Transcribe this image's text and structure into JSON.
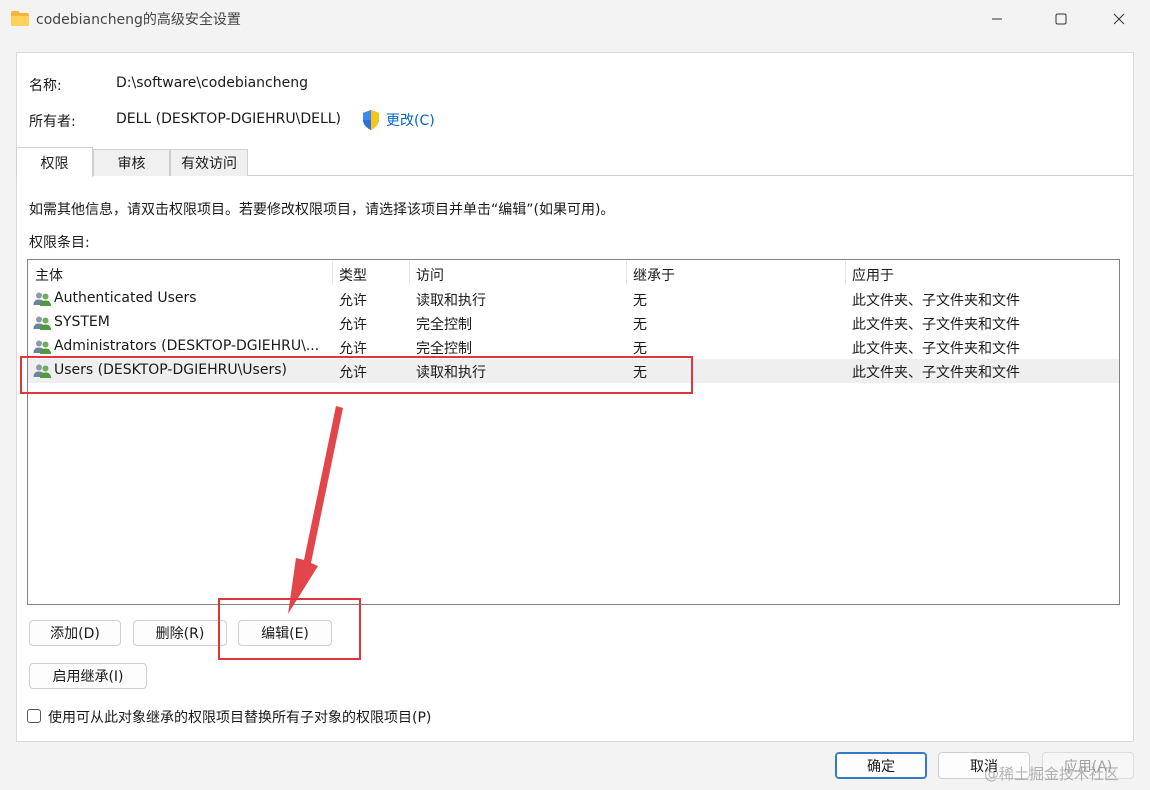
{
  "window": {
    "title": "codebiancheng的高级安全设置",
    "controls": {
      "minimize": "—",
      "maximize": "☐",
      "close": "✕"
    }
  },
  "info": {
    "name_label": "名称:",
    "name_value": "D:\\software\\codebiancheng",
    "owner_label": "所有者:",
    "owner_value": "DELL (DESKTOP-DGIEHRU\\DELL)",
    "change_link": "更改(C)"
  },
  "tabs": [
    {
      "label": "权限",
      "active": true
    },
    {
      "label": "审核",
      "active": false
    },
    {
      "label": "有效访问",
      "active": false
    }
  ],
  "instructions": "如需其他信息，请双击权限项目。若要修改权限项目，请选择该项目并单击“编辑”(如果可用)。",
  "entries_label": "权限条目:",
  "table": {
    "columns": [
      "主体",
      "类型",
      "访问",
      "继承于",
      "应用于"
    ],
    "rows": [
      {
        "principal": "Authenticated Users",
        "type": "允许",
        "access": "读取和执行",
        "inherited": "无",
        "applies": "此文件夹、子文件夹和文件"
      },
      {
        "principal": "SYSTEM",
        "type": "允许",
        "access": "完全控制",
        "inherited": "无",
        "applies": "此文件夹、子文件夹和文件"
      },
      {
        "principal": "Administrators (DESKTOP-DGIEHRU\\...",
        "type": "允许",
        "access": "完全控制",
        "inherited": "无",
        "applies": "此文件夹、子文件夹和文件"
      },
      {
        "principal": "Users (DESKTOP-DGIEHRU\\Users)",
        "type": "允许",
        "access": "读取和执行",
        "inherited": "无",
        "applies": "此文件夹、子文件夹和文件",
        "selected": true
      }
    ]
  },
  "buttons": {
    "add": "添加(D)",
    "remove": "删除(R)",
    "edit": "编辑(E)",
    "enable_inheritance": "启用继承(I)"
  },
  "replace_checkbox": {
    "label": "使用可从此对象继承的权限项目替换所有子对象的权限项目(P)",
    "checked": false
  },
  "footer": {
    "ok": "确定",
    "cancel": "取消",
    "apply": "应用(A)"
  },
  "watermark": "@稀土掘金技术社区",
  "colors": {
    "accent": "#0067c0",
    "annotation": "#e0353b",
    "selected_row": "#efefef"
  }
}
